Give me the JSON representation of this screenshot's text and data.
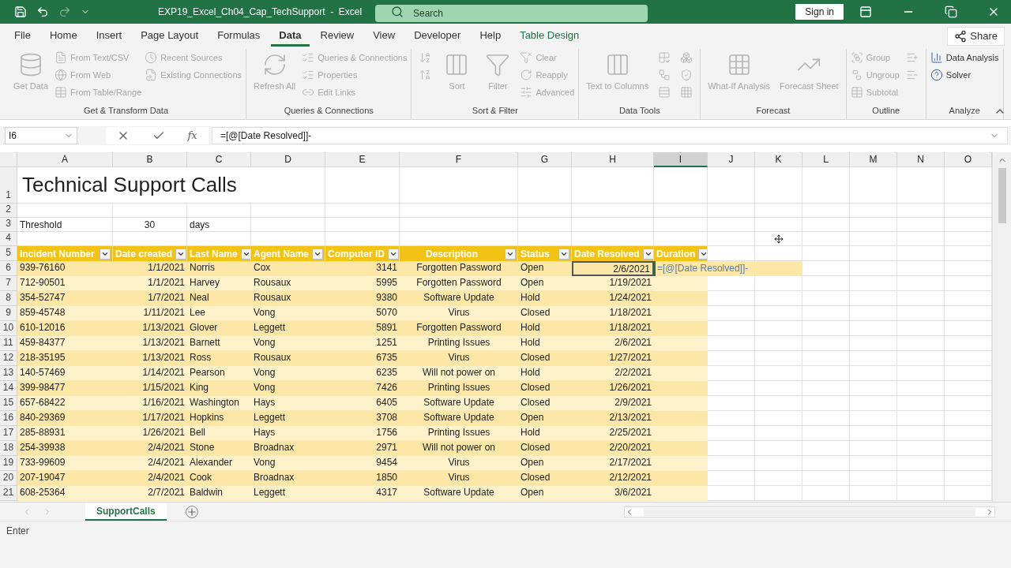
{
  "titlebar": {
    "title": "EXP19_Excel_Ch04_Cap_TechSupport  -  Excel",
    "search_placeholder": "Search",
    "sign_in": "Sign in"
  },
  "menu_tabs": [
    {
      "label": "File",
      "selected": false,
      "kind": "normal"
    },
    {
      "label": "Home",
      "selected": false,
      "kind": "normal"
    },
    {
      "label": "Insert",
      "selected": false,
      "kind": "normal"
    },
    {
      "label": "Page Layout",
      "selected": false,
      "kind": "normal"
    },
    {
      "label": "Formulas",
      "selected": false,
      "kind": "normal"
    },
    {
      "label": "Data",
      "selected": true,
      "kind": "normal"
    },
    {
      "label": "Review",
      "selected": false,
      "kind": "normal"
    },
    {
      "label": "View",
      "selected": false,
      "kind": "normal"
    },
    {
      "label": "Developer",
      "selected": false,
      "kind": "normal"
    },
    {
      "label": "Help",
      "selected": false,
      "kind": "normal"
    },
    {
      "label": "Table Design",
      "selected": false,
      "kind": "contextual"
    }
  ],
  "share": "Share",
  "ribbon_groups": [
    {
      "label": "Get & Transform Data",
      "items": [
        {
          "label": "Get Data",
          "kind": "large",
          "disabled": true
        },
        {
          "label": "From Text/CSV",
          "kind": "small",
          "disabled": true
        },
        {
          "label": "From Web",
          "kind": "small",
          "disabled": true
        },
        {
          "label": "From Table/Range",
          "kind": "small",
          "disabled": true
        },
        {
          "label": "Recent Sources",
          "kind": "small",
          "disabled": true
        },
        {
          "label": "Existing Connections",
          "kind": "small",
          "disabled": true
        }
      ]
    },
    {
      "label": "Queries & Connections",
      "items": [
        {
          "label": "Refresh All",
          "kind": "large",
          "disabled": true
        },
        {
          "label": "Queries & Connections",
          "kind": "small",
          "disabled": true
        },
        {
          "label": "Properties",
          "kind": "small",
          "disabled": true
        },
        {
          "label": "Edit Links",
          "kind": "small",
          "disabled": true
        }
      ]
    },
    {
      "label": "Sort & Filter",
      "items": [
        {
          "kind": "icon",
          "disabled": true
        },
        {
          "kind": "icon",
          "disabled": true
        },
        {
          "label": "Sort",
          "kind": "large",
          "disabled": true
        },
        {
          "label": "Filter",
          "kind": "large",
          "disabled": true
        },
        {
          "label": "Clear",
          "kind": "small",
          "disabled": true
        },
        {
          "label": "Reapply",
          "kind": "small",
          "disabled": true
        },
        {
          "label": "Advanced",
          "kind": "small",
          "disabled": true
        }
      ]
    },
    {
      "label": "Data Tools",
      "items": [
        {
          "label": "Text to Columns",
          "kind": "large",
          "disabled": true
        },
        {
          "kind": "icon",
          "disabled": true
        },
        {
          "kind": "icon",
          "disabled": true
        },
        {
          "kind": "icon",
          "disabled": true
        },
        {
          "kind": "icon",
          "disabled": true
        },
        {
          "kind": "icon",
          "disabled": true
        },
        {
          "kind": "icon",
          "disabled": true
        }
      ]
    },
    {
      "label": "Forecast",
      "items": [
        {
          "label": "What-If Analysis",
          "kind": "large",
          "disabled": true
        },
        {
          "label": "Forecast Sheet",
          "kind": "large",
          "disabled": true
        }
      ]
    },
    {
      "label": "Outline",
      "items": [
        {
          "label": "Group",
          "kind": "small",
          "disabled": true
        },
        {
          "label": "Ungroup",
          "kind": "small",
          "disabled": true
        },
        {
          "label": "Subtotal",
          "kind": "small",
          "disabled": true
        },
        {
          "kind": "icon",
          "disabled": true
        },
        {
          "kind": "icon",
          "disabled": true
        }
      ]
    },
    {
      "label": "Analyze",
      "items": [
        {
          "label": "Data Analysis",
          "kind": "small",
          "disabled": false
        },
        {
          "label": "Solver",
          "kind": "small",
          "disabled": false
        }
      ]
    }
  ],
  "name_box": "I6",
  "fx_label": "fx",
  "formula": "=[@[Date Resolved]]-",
  "columns": [
    {
      "label": "A",
      "selected": false
    },
    {
      "label": "B",
      "selected": false
    },
    {
      "label": "C",
      "selected": false
    },
    {
      "label": "D",
      "selected": false
    },
    {
      "label": "E",
      "selected": false
    },
    {
      "label": "F",
      "selected": false
    },
    {
      "label": "G",
      "selected": false
    },
    {
      "label": "H",
      "selected": false
    },
    {
      "label": "I",
      "selected": true
    },
    {
      "label": "J",
      "selected": false
    },
    {
      "label": "K",
      "selected": false
    },
    {
      "label": "L",
      "selected": false
    },
    {
      "label": "M",
      "selected": false
    },
    {
      "label": "N",
      "selected": false
    },
    {
      "label": "O",
      "selected": false
    }
  ],
  "sheet": {
    "title": "Technical Support Calls",
    "threshold_label": "Threshold",
    "threshold_value": "30",
    "threshold_unit": "days",
    "top_row_numbers": [
      "1",
      "2",
      "3",
      "4",
      "5"
    ],
    "headers": [
      "Incident Number",
      "Date created",
      "Last Name",
      "Agent Name",
      "Computer ID",
      "Description",
      "Status",
      "Date Resolved",
      "Duration"
    ],
    "rows": [
      {
        "num": "6",
        "cells": [
          "939-76160",
          "1/1/2021",
          "Norris",
          "Cox",
          "3141",
          "Forgotten Password",
          "Open",
          "2/6/2021"
        ],
        "selected": true,
        "editing": "=[@[Date Resolved]]-"
      },
      {
        "num": "7",
        "cells": [
          "712-90501",
          "1/1/2021",
          "Harvey",
          "Rousaux",
          "5995",
          "Forgotten Password",
          "Open",
          "1/19/2021"
        ],
        "selected": false
      },
      {
        "num": "8",
        "cells": [
          "354-52747",
          "1/7/2021",
          "Neal",
          "Rousaux",
          "9380",
          "Software Update",
          "Hold",
          "1/24/2021"
        ],
        "selected": false
      },
      {
        "num": "9",
        "cells": [
          "859-45748",
          "1/11/2021",
          "Lee",
          "Vong",
          "5070",
          "Virus",
          "Closed",
          "1/18/2021"
        ],
        "selected": false
      },
      {
        "num": "10",
        "cells": [
          "610-12016",
          "1/13/2021",
          "Glover",
          "Leggett",
          "5891",
          "Forgotten Password",
          "Hold",
          "1/18/2021"
        ],
        "selected": false
      },
      {
        "num": "11",
        "cells": [
          "459-84377",
          "1/13/2021",
          "Barnett",
          "Vong",
          "1251",
          "Printing Issues",
          "Hold",
          "2/6/2021"
        ],
        "selected": false
      },
      {
        "num": "12",
        "cells": [
          "218-35195",
          "1/13/2021",
          "Ross",
          "Rousaux",
          "6735",
          "Virus",
          "Closed",
          "1/27/2021"
        ],
        "selected": false
      },
      {
        "num": "13",
        "cells": [
          "140-57469",
          "1/14/2021",
          "Pearson",
          "Vong",
          "6235",
          "Will not power on",
          "Hold",
          "2/2/2021"
        ],
        "selected": false
      },
      {
        "num": "14",
        "cells": [
          "399-98477",
          "1/15/2021",
          "King",
          "Vong",
          "7426",
          "Printing Issues",
          "Closed",
          "1/26/2021"
        ],
        "selected": false
      },
      {
        "num": "15",
        "cells": [
          "657-68422",
          "1/16/2021",
          "Washington",
          "Hays",
          "6405",
          "Software Update",
          "Closed",
          "2/9/2021"
        ],
        "selected": false
      },
      {
        "num": "16",
        "cells": [
          "840-29369",
          "1/17/2021",
          "Hopkins",
          "Leggett",
          "3708",
          "Software Update",
          "Open",
          "2/13/2021"
        ],
        "selected": false
      },
      {
        "num": "17",
        "cells": [
          "285-88931",
          "1/26/2021",
          "Bell",
          "Hays",
          "1756",
          "Printing Issues",
          "Hold",
          "2/25/2021"
        ],
        "selected": false
      },
      {
        "num": "18",
        "cells": [
          "254-39938",
          "2/4/2021",
          "Stone",
          "Broadnax",
          "2971",
          "Will not power on",
          "Closed",
          "2/20/2021"
        ],
        "selected": false
      },
      {
        "num": "19",
        "cells": [
          "733-99609",
          "2/4/2021",
          "Alexander",
          "Vong",
          "9454",
          "Virus",
          "Open",
          "2/17/2021"
        ],
        "selected": false
      },
      {
        "num": "20",
        "cells": [
          "207-19047",
          "2/4/2021",
          "Cook",
          "Broadnax",
          "1850",
          "Virus",
          "Closed",
          "2/12/2021"
        ],
        "selected": false
      },
      {
        "num": "21",
        "cells": [
          "608-25364",
          "2/7/2021",
          "Baldwin",
          "Leggett",
          "4317",
          "Software Update",
          "Open",
          "3/6/2021"
        ],
        "selected": false
      }
    ]
  },
  "sheet_tabs": [
    {
      "label": "SupportCalls",
      "selected": true
    }
  ],
  "status": "Enter"
}
